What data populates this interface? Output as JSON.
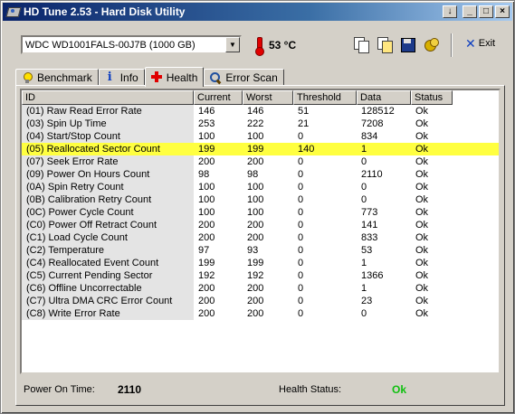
{
  "window": {
    "title": "HD Tune 2.53 - Hard Disk Utility"
  },
  "toolbar": {
    "drive": "WDC WD1001FALS-00J7B (1000 GB)",
    "temperature": "53 °C",
    "exit_label": "Exit",
    "icons": [
      "copy-text-icon",
      "copy-screenshot-icon",
      "save-icon",
      "options-icon",
      "exit-icon"
    ]
  },
  "tabs": [
    {
      "label": "Benchmark",
      "icon": "bulb-icon"
    },
    {
      "label": "Info",
      "icon": "info-icon"
    },
    {
      "label": "Health",
      "icon": "health-cross-icon",
      "active": true
    },
    {
      "label": "Error Scan",
      "icon": "magnifier-icon"
    }
  ],
  "table": {
    "columns": [
      "ID",
      "Current",
      "Worst",
      "Threshold",
      "Data",
      "Status"
    ],
    "rows": [
      [
        "(01) Raw Read Error Rate",
        "146",
        "146",
        "51",
        "128512",
        "Ok"
      ],
      [
        "(03) Spin Up Time",
        "253",
        "222",
        "21",
        "7208",
        "Ok"
      ],
      [
        "(04) Start/Stop Count",
        "100",
        "100",
        "0",
        "834",
        "Ok"
      ],
      [
        "(05) Reallocated Sector Count",
        "199",
        "199",
        "140",
        "1",
        "Ok"
      ],
      [
        "(07) Seek Error Rate",
        "200",
        "200",
        "0",
        "0",
        "Ok"
      ],
      [
        "(09) Power On Hours Count",
        "98",
        "98",
        "0",
        "2110",
        "Ok"
      ],
      [
        "(0A) Spin Retry Count",
        "100",
        "100",
        "0",
        "0",
        "Ok"
      ],
      [
        "(0B) Calibration Retry Count",
        "100",
        "100",
        "0",
        "0",
        "Ok"
      ],
      [
        "(0C) Power Cycle Count",
        "100",
        "100",
        "0",
        "773",
        "Ok"
      ],
      [
        "(C0) Power Off Retract Count",
        "200",
        "200",
        "0",
        "141",
        "Ok"
      ],
      [
        "(C1) Load Cycle Count",
        "200",
        "200",
        "0",
        "833",
        "Ok"
      ],
      [
        "(C2) Temperature",
        "97",
        "93",
        "0",
        "53",
        "Ok"
      ],
      [
        "(C4) Reallocated Event Count",
        "199",
        "199",
        "0",
        "1",
        "Ok"
      ],
      [
        "(C5) Current Pending Sector",
        "192",
        "192",
        "0",
        "1366",
        "Ok"
      ],
      [
        "(C6) Offline Uncorrectable",
        "200",
        "200",
        "0",
        "1",
        "Ok"
      ],
      [
        "(C7) Ultra DMA CRC Error Count",
        "200",
        "200",
        "0",
        "23",
        "Ok"
      ],
      [
        "(C8) Write Error Rate",
        "200",
        "200",
        "0",
        "0",
        "Ok"
      ]
    ],
    "highlighted_row": 3,
    "highlight_color": "#ffff40"
  },
  "footer": {
    "power_on_label": "Power On Time:",
    "power_on_value": "2110",
    "health_label": "Health Status:",
    "health_value": "Ok",
    "health_color": "#10c010"
  }
}
